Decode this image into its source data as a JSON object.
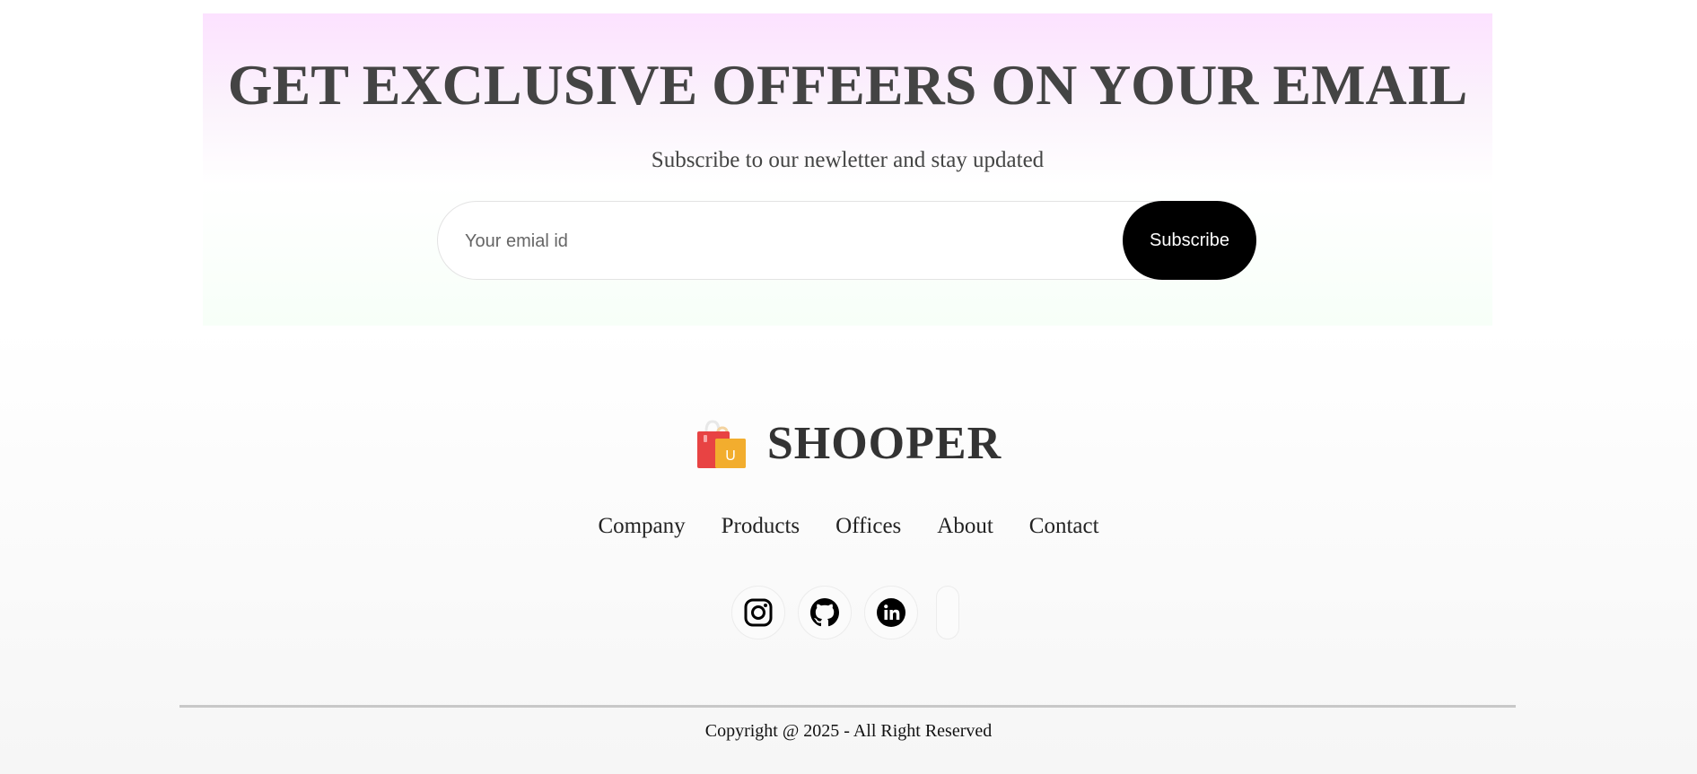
{
  "newsletter": {
    "title": "GET EXCLUSIVE OFFEERS ON YOUR EMAIL",
    "subtitle": "Subscribe to our newletter and stay updated",
    "email_placeholder": "Your emial id",
    "subscribe_label": "Subscribe"
  },
  "footer": {
    "brand_name": "SHOOPER",
    "logo_icon": "shopping-bags-icon",
    "links": [
      {
        "label": "Company"
      },
      {
        "label": "Products"
      },
      {
        "label": "Offices"
      },
      {
        "label": "About"
      },
      {
        "label": "Contact"
      }
    ],
    "socials": [
      {
        "icon": "instagram-icon"
      },
      {
        "icon": "github-icon"
      },
      {
        "icon": "linkedin-icon"
      },
      {
        "icon": "empty-social-slot"
      }
    ],
    "copyright": "Copyright @ 2025 - All Right Reserved"
  },
  "colors": {
    "accent_black": "#000000",
    "heading_gray": "#444444",
    "newsletter_pink": "#fce2ff",
    "newsletter_green": "#f7fff8"
  }
}
